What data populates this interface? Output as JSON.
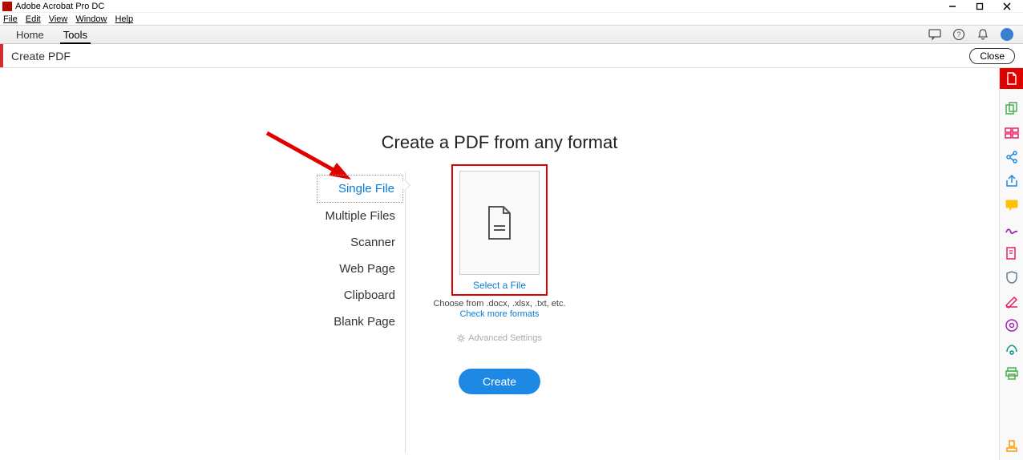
{
  "titlebar": {
    "app_name": "Adobe Acrobat Pro DC"
  },
  "menubar": {
    "file": "File",
    "edit": "Edit",
    "view": "View",
    "window": "Window",
    "help": "Help"
  },
  "tabs": {
    "home": "Home",
    "tools": "Tools"
  },
  "subbar": {
    "title": "Create PDF",
    "close": "Close"
  },
  "main": {
    "heading": "Create a PDF from any format",
    "options": {
      "single": "Single File",
      "multiple": "Multiple Files",
      "scanner": "Scanner",
      "webpage": "Web Page",
      "clipboard": "Clipboard",
      "blank": "Blank Page"
    },
    "select_file": "Select a File",
    "choose_from": "Choose from .docx, .xlsx, .txt, etc.",
    "check_more": "Check more formats",
    "advanced": "Advanced Settings",
    "create": "Create"
  },
  "colors": {
    "accent_red": "#e10000",
    "accent_blue": "#1e88e5",
    "link": "#0a7bd6"
  }
}
